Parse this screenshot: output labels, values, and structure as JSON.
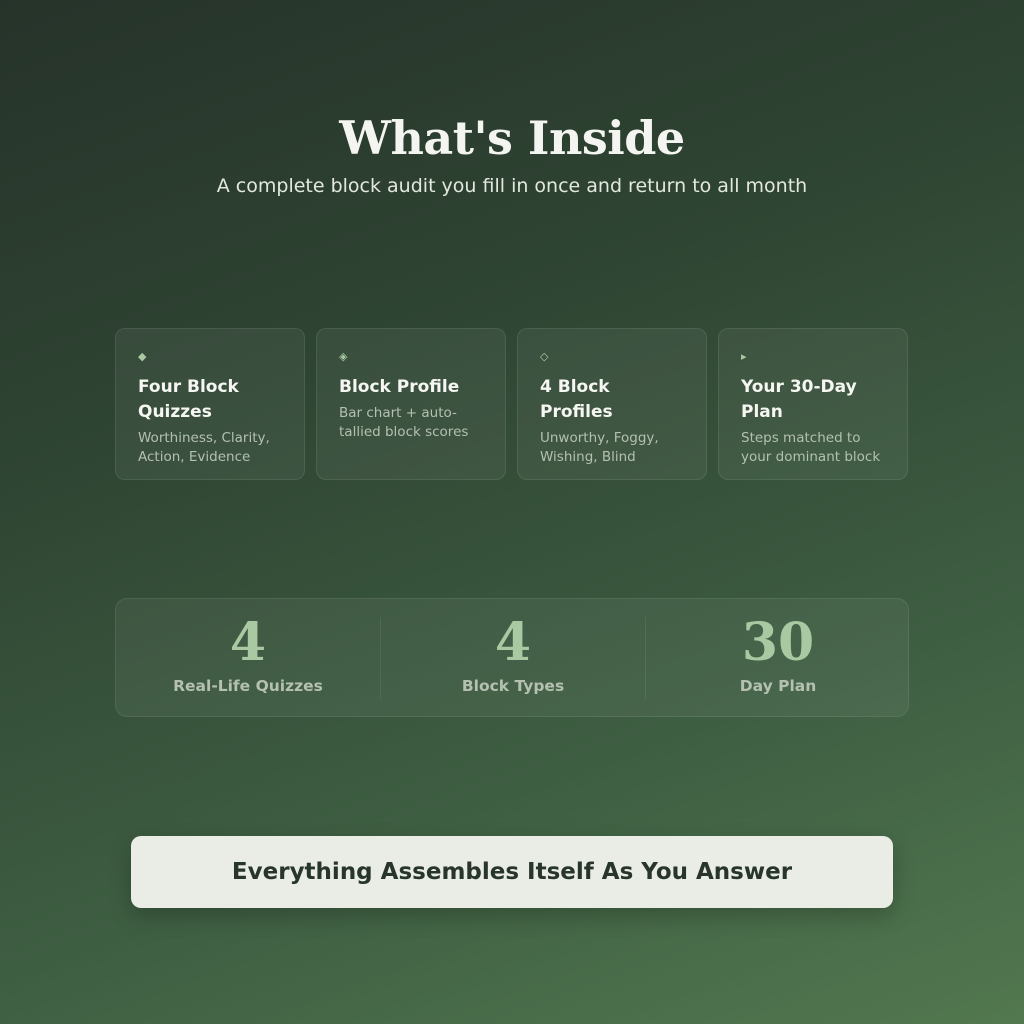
{
  "header": {
    "title": "What's Inside",
    "subtitle": "A complete block audit you fill in once and return to all month"
  },
  "cards": [
    {
      "icon": "◆",
      "icon_name": "solid-diamond-icon",
      "title": "Four Block Quizzes",
      "description": "Worthiness, Clarity, Action, Evidence"
    },
    {
      "icon": "◈",
      "icon_name": "diamond-in-diamond-icon",
      "title": "Block Profile",
      "description": "Bar chart + auto-tallied block scores"
    },
    {
      "icon": "◇",
      "icon_name": "outline-diamond-icon",
      "title": "4 Block Profiles",
      "description": "Unworthy, Foggy, Wishing, Blind"
    },
    {
      "icon": "▸",
      "icon_name": "triangle-right-icon",
      "title": "Your 30-Day Plan",
      "description": "Steps matched to your dominant block"
    }
  ],
  "stats": [
    {
      "value": "4",
      "label": "Real-Life Quizzes"
    },
    {
      "value": "4",
      "label": "Block Types"
    },
    {
      "value": "30",
      "label": "Day Plan"
    }
  ],
  "cta": {
    "label": "Everything Assembles Itself As You Answer"
  },
  "colors": {
    "accent": "#a9c9a2",
    "background_top": "#26332a",
    "background_bottom": "#52784f",
    "cta_background": "#e9ede6",
    "cta_text": "#28352a"
  }
}
